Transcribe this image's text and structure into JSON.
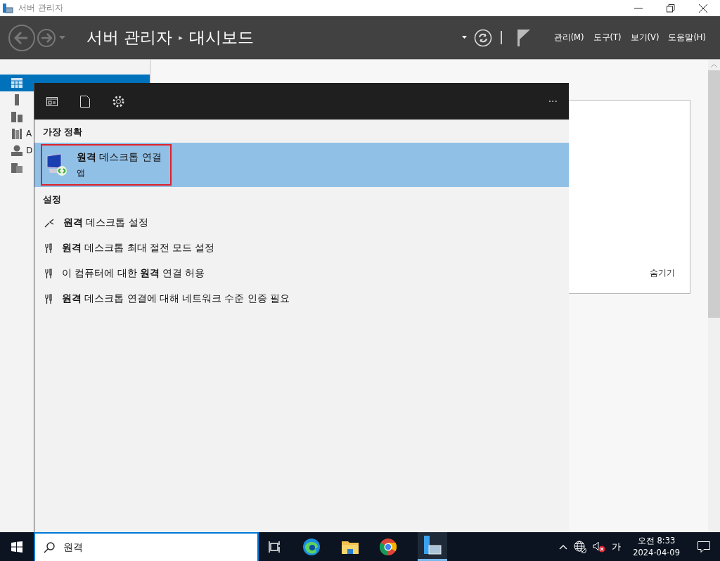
{
  "window": {
    "title": "서버 관리자"
  },
  "header": {
    "app": "서버 관리자",
    "separator": "▸",
    "page": "대시보드",
    "menus": [
      "관리(M)",
      "도구(T)",
      "보기(V)",
      "도움말(H)"
    ]
  },
  "sidebar": {
    "items": [
      {
        "selected": true,
        "kind": "dashboard"
      },
      {
        "selected": false,
        "kind": "local"
      },
      {
        "selected": false,
        "kind": "all"
      },
      {
        "selected": false,
        "kind": "ad",
        "label": "A"
      },
      {
        "selected": false,
        "kind": "dns",
        "label": "D"
      },
      {
        "selected": false,
        "kind": "files"
      }
    ]
  },
  "panel": {
    "hide_link": "숨기기"
  },
  "search_popup": {
    "more": "···",
    "best_match": {
      "heading": "가장 정확",
      "title": "**원격** 데스크톱 연결",
      "subtitle": "앱",
      "selected": true,
      "outlined": true
    },
    "settings": {
      "heading": "설정",
      "items": [
        {
          "kind": "remote",
          "text": "**원격** 데스크톱 설정"
        },
        {
          "kind": "tool",
          "text": "**원격** 데스크톱 최대 절전 모드 설정"
        },
        {
          "kind": "tool",
          "text": "이 컴퓨터에 대한 **원격** 연결 허용"
        },
        {
          "kind": "tool",
          "text": "**원격** 데스크톱 연결에 대해 네트워크 수준 인증 필요"
        }
      ]
    }
  },
  "taskbar": {
    "search_value": "원격",
    "ime": "가",
    "time": "오전 8:33",
    "date": "2024-04-09"
  }
}
